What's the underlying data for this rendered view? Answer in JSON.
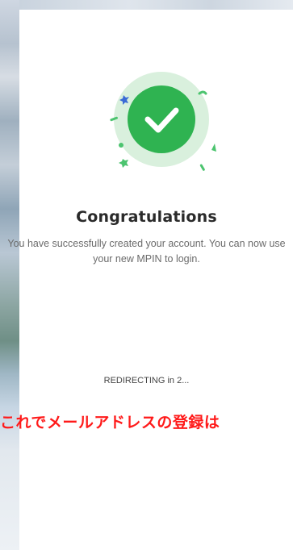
{
  "success": {
    "title": "Congratulations",
    "message": "You have successfully created your account. You can now use your new MPIN to login.",
    "redirect_text": "REDIRECTING in 2..."
  },
  "overlay": {
    "caption": "これでメールアドレスの登録は"
  },
  "colors": {
    "check_circle": "#2fb351",
    "halo": "#d9f0dd",
    "confetti_green": "#4cc46f",
    "confetti_blue": "#3b6bd6",
    "caption_red": "#ff1a1a"
  },
  "icons": {
    "success": "checkmark-icon"
  }
}
